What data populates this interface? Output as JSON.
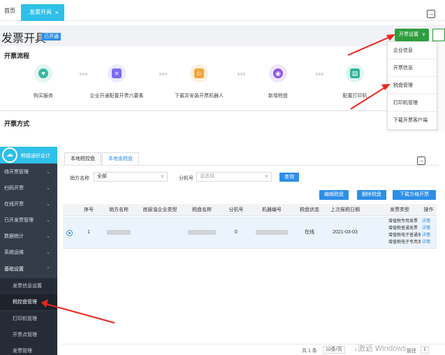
{
  "top": {
    "tabs": {
      "home": "首页",
      "invoice": "发票开具",
      "close": "×"
    },
    "title": "发票开具",
    "status_badge": "已开通",
    "settings_button": "开票设置",
    "flow_title": "开票流程",
    "steps": [
      {
        "label": "购买服务",
        "color": "#3ab7a1"
      },
      {
        "label": "企业开通配置开票六要素",
        "color": "#7b6cf0"
      },
      {
        "label": "下载并安装开票机器人",
        "color": "#f2a43a"
      },
      {
        "label": "新增税盘",
        "color": "#8a57e6"
      },
      {
        "label": "配置打印机",
        "color": "#2fb39a"
      }
    ],
    "dropdown": [
      "企业信息",
      "开票信息",
      "税盘管理",
      "打印机管理",
      "下载开票客户端"
    ],
    "method_title": "开票方式"
  },
  "bottom": {
    "logo_text": "畅捷通好会计",
    "sidebar": [
      {
        "label": "待开票管理",
        "chev": "⌄"
      },
      {
        "label": "扫码开票",
        "chev": "⌄"
      },
      {
        "label": "在线开票",
        "chev": "⌄"
      },
      {
        "label": "已开发票管理",
        "chev": "⌄"
      },
      {
        "label": "数据统计",
        "chev": "⌄"
      },
      {
        "label": "系统运维",
        "chev": "⌄"
      },
      {
        "label": "基础设置",
        "chev": "⌃"
      }
    ],
    "sidebar_sub": [
      "发票信息设置",
      "税控盘管理",
      "打印机管理",
      "开票点管理",
      "发票管理"
    ],
    "tabs": [
      "本地税控盘",
      "本地金税盘"
    ],
    "filters": {
      "seller_label": "销方名称",
      "seller_value": "全部",
      "ext_label": "分机号",
      "ext_placeholder": "请选择",
      "query": "查询"
    },
    "actions": [
      "编辑税盘",
      "删除税盘",
      "下载方格开票"
    ],
    "columns": [
      "序号",
      "销方名称",
      "底层油企业类型",
      "税盘名称",
      "分机号",
      "机器编号",
      "税盘状态",
      "上次报税日期",
      "发票类型",
      "操作"
    ],
    "row": {
      "index": "1",
      "ext_no": "0",
      "status": "在线",
      "last_tax_date": "2021-03-03",
      "invoice_types": [
        "增值税专用发票",
        "增值税普通发票",
        "增值税电子普通发",
        "增值税电子专用发"
      ],
      "ops": [
        "详情",
        "详情",
        "详情",
        "详情"
      ]
    },
    "footer": {
      "total": "共 1 条",
      "page_size": "10条/页",
      "page": "1",
      "goto": "前往",
      "goto_page": "1"
    },
    "watermark": "激活 Windows"
  }
}
